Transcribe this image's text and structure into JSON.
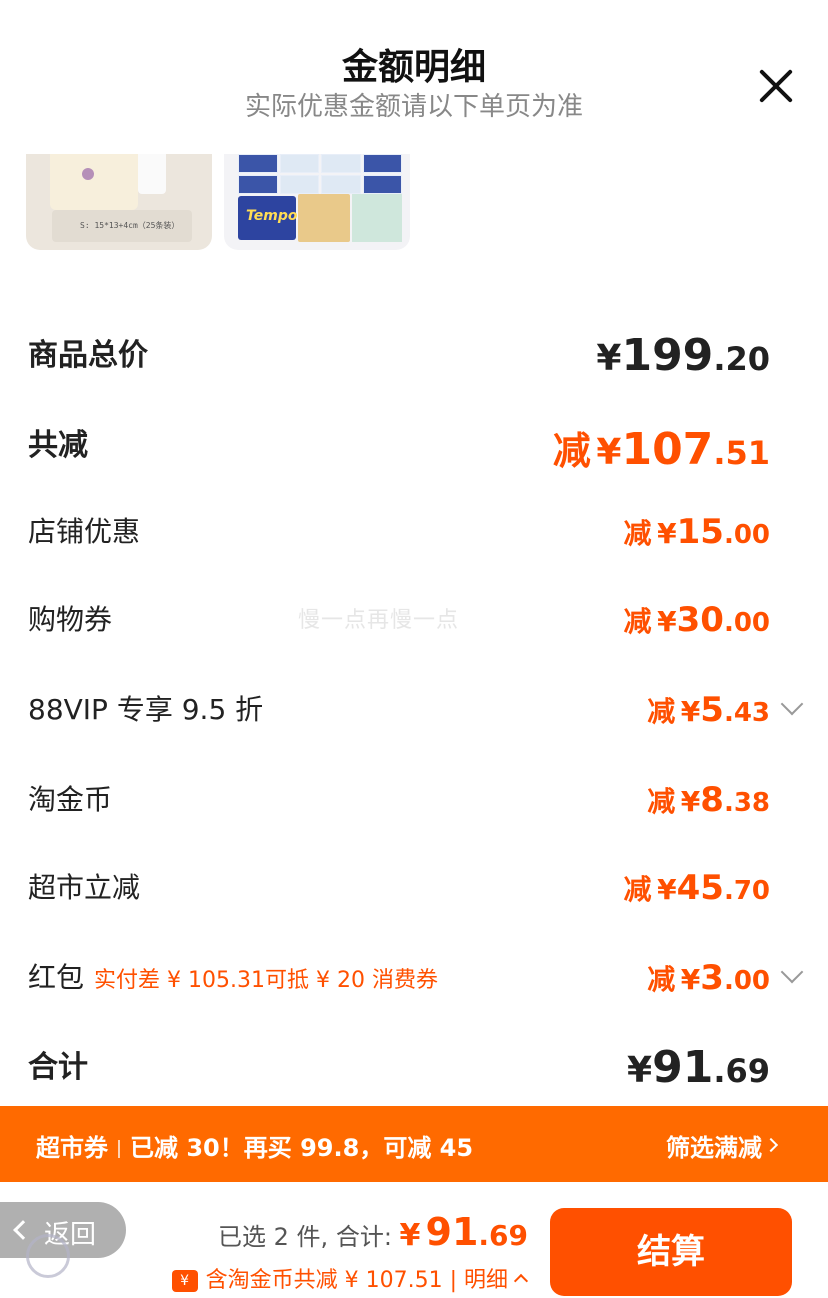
{
  "header": {
    "title": "金额明细",
    "subtitle": "实际优惠金额请以下单页为准"
  },
  "products": [
    {
      "caption": "S: 15*13+4cm（25条装）"
    },
    {
      "caption": "Tempo"
    }
  ],
  "rows": {
    "total_goods": {
      "label": "商品总价",
      "currency": "¥",
      "int": "199",
      "dec": ".20"
    },
    "total_discount": {
      "label": "共减",
      "prefix": "减",
      "currency": "¥",
      "int": "107",
      "dec": ".51"
    },
    "store": {
      "label": "店铺优惠",
      "prefix": "减",
      "currency": "¥",
      "int": "15",
      "dec": ".00"
    },
    "coupon": {
      "label": "购物券",
      "prefix": "减",
      "currency": "¥",
      "int": "30",
      "dec": ".00"
    },
    "vip": {
      "label": "88VIP 专享 9.5 折",
      "prefix": "减",
      "currency": "¥",
      "int": "5",
      "dec": ".43"
    },
    "coins": {
      "label": "淘金币",
      "prefix": "减",
      "currency": "¥",
      "int": "8",
      "dec": ".38"
    },
    "market": {
      "label": "超市立减",
      "prefix": "减",
      "currency": "¥",
      "int": "45",
      "dec": ".70"
    },
    "redpacket": {
      "label": "红包",
      "note": "实付差 ¥ 105.31可抵 ¥ 20 消费券",
      "prefix": "减",
      "currency": "¥",
      "int": "3",
      "dec": ".00"
    },
    "sum": {
      "label": "合计",
      "currency": "¥",
      "int": "91",
      "dec": ".69"
    }
  },
  "watermark": "慢一点再慢一点",
  "banner": {
    "tag": "超市券",
    "text": "已减 30！再买 99.8，可减 45",
    "action": "筛选满减"
  },
  "bottom": {
    "back": "返回",
    "selected": "已选 2 件, 合计: ",
    "currency": "¥",
    "int": "91",
    "dec": ".69",
    "coin_icon": "¥",
    "detail": "含淘金币共减 ¥ 107.51 | 明细",
    "checkout": "结算"
  },
  "colors": {
    "accent": "#ff5000",
    "banner": "#ff6a00",
    "text": "#222222",
    "muted": "#888888"
  }
}
